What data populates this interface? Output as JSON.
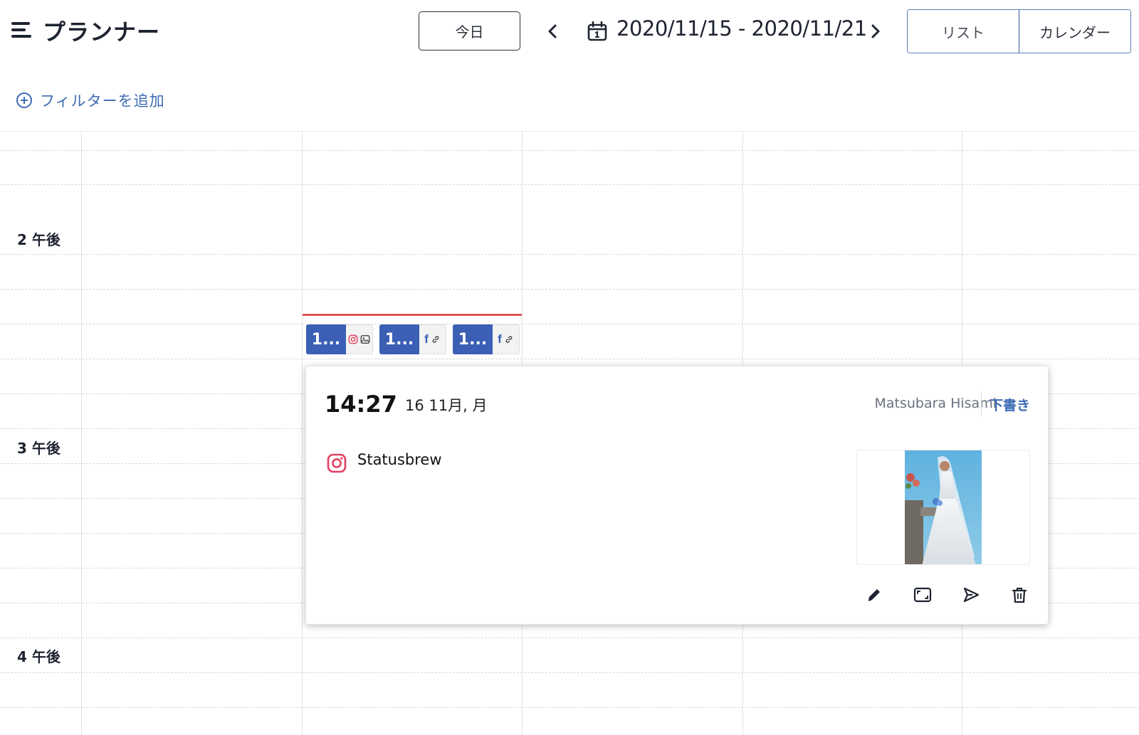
{
  "header": {
    "title": "プランナー",
    "today_label": "今日",
    "date_range": "2020/11/15 - 2020/11/21",
    "views": [
      {
        "label": "リスト",
        "active": false
      },
      {
        "label": "カレンダー",
        "active": true
      }
    ]
  },
  "filter": {
    "add_label": "フィルターを追加"
  },
  "calendar": {
    "hour_labels": [
      "2 午後",
      "3 午後",
      "4 午後"
    ],
    "events": [
      {
        "time_label": "1...",
        "network": "instagram",
        "type": "image"
      },
      {
        "time_label": "1...",
        "network": "facebook",
        "type": "link"
      },
      {
        "time_label": "1...",
        "network": "facebook",
        "type": "link"
      }
    ]
  },
  "popover": {
    "time": "14:27",
    "date": "16 11月, 月",
    "author": "Matsubara Hisami",
    "status": "下書き",
    "account_name": "Statusbrew",
    "network": "instagram",
    "actions": [
      "edit-icon",
      "expand-icon",
      "send-icon",
      "delete-icon"
    ]
  },
  "colors": {
    "accent": "#3b5fb5",
    "link": "#3d6bb3",
    "now_line": "#e05252",
    "instagram": "#e4405f"
  }
}
